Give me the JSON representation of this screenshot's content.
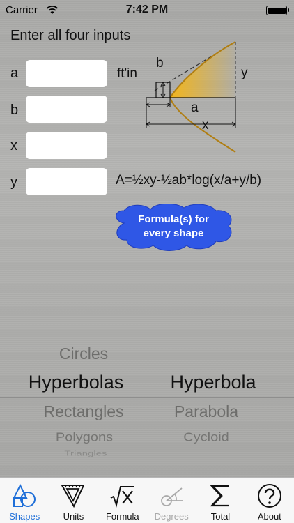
{
  "status": {
    "carrier": "Carrier",
    "time": "7:42 PM"
  },
  "instruction": "Enter all four inputs",
  "inputs": [
    {
      "label": "a",
      "value": ""
    },
    {
      "label": "b",
      "value": ""
    },
    {
      "label": "x",
      "value": ""
    },
    {
      "label": "y",
      "value": ""
    }
  ],
  "unit_label": "ft'in",
  "formula": "A=½xy-½ab*log(x/a+y/b)",
  "diagram": {
    "label_b": "b",
    "label_a": "a",
    "label_y": "y",
    "label_x": "x",
    "fill_color": "#f2b51b"
  },
  "callout": {
    "line1": "Formula(s) for",
    "line2": "every shape",
    "color": "#2f57e6"
  },
  "picker": {
    "categories": [
      "Circles",
      "Hyperbolas",
      "Rectangles",
      "Polygons",
      "Triangles"
    ],
    "selected_category": "Hyperbolas",
    "shapes": [
      "Hyperbola",
      "Parabola",
      "Cycloid"
    ],
    "selected_shape": "Hyperbola"
  },
  "tabs": [
    {
      "label": "Shapes",
      "icon": "shapes-icon",
      "state": "selected"
    },
    {
      "label": "Units",
      "icon": "units-icon",
      "state": "normal"
    },
    {
      "label": "Formula",
      "icon": "formula-icon",
      "state": "normal"
    },
    {
      "label": "Degrees",
      "icon": "degrees-icon",
      "state": "disabled"
    },
    {
      "label": "Total",
      "icon": "total-icon",
      "state": "normal"
    },
    {
      "label": "About",
      "icon": "about-icon",
      "state": "normal"
    }
  ],
  "colors": {
    "accent": "#1f6fd8",
    "disabled": "#a9a9a9"
  }
}
